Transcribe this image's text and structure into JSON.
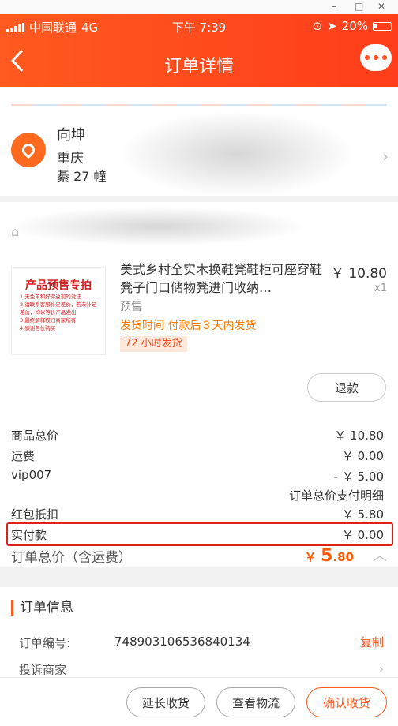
{
  "window_controls": {
    "minimize": "–",
    "maximize": "□",
    "close": "✕"
  },
  "status_bar": {
    "carrier": "中国联通",
    "network": "4G",
    "time": "下午 7:39",
    "battery": "20%"
  },
  "nav": {
    "title": "订单详情",
    "back_icon": "chevron-left-icon",
    "chat_icon": "chat-bubble-icon"
  },
  "address": {
    "name": "向坤",
    "city": "重庆",
    "detail": "綦 27 幢"
  },
  "product": {
    "image_title": "产品预售专拍",
    "image_lines": [
      "1.无免单和好评返现的说法",
      "2.请联系客服补足差价，若未补足差价，均以等价产品发出",
      "3.最终解释权归商家所有",
      "4.感谢各位购买"
    ],
    "title": "美式乡村全实木换鞋凳鞋柜可座穿鞋凳子门口储物凳进门收纳…",
    "price": "￥ 10.80",
    "qty": "x1",
    "presale_label": "预售",
    "ship_time": "发货时间  付款后３天内发货",
    "badge": "72 小时发货",
    "refund_label": "退款"
  },
  "price_rows": [
    {
      "label": "商品总价",
      "value": "￥ 10.80"
    },
    {
      "label": "运费",
      "value": "￥ 0.00"
    },
    {
      "label": "vip007",
      "value": "- ￥ 5.00"
    }
  ],
  "payment_note": "订单总价支付明细",
  "coupon": {
    "label": "红包抵扣",
    "value": "￥ 5.80"
  },
  "paid": {
    "label": "实付款",
    "value": "￥ 0.00"
  },
  "order_total": {
    "label": "订单总价（含运费）",
    "currency": "￥",
    "big": "5",
    "small": ".80"
  },
  "order_info": {
    "title": "订单信息",
    "order_no_label": "订单编号:",
    "order_no": "748903106536840134",
    "copy_label": "复制",
    "complain_label": "投诉商家"
  },
  "bottom_buttons": {
    "extend": "延长收货",
    "logistics": "查看物流",
    "confirm": "确认收货"
  },
  "colors": {
    "accent": "#ff5a1f",
    "highlight_box": "#e0201a"
  }
}
